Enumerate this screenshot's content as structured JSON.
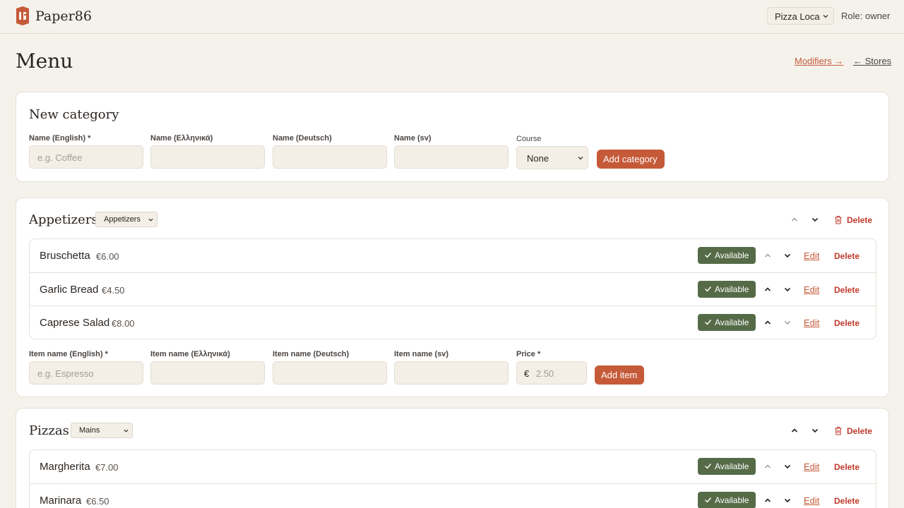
{
  "header": {
    "brand": "Paper86",
    "store": "Pizza Loca",
    "role": "Role: owner"
  },
  "page": {
    "title": "Menu",
    "modifiers_link": "Modifiers →",
    "stores_link": "← Stores"
  },
  "new_category": {
    "title": "New category",
    "fields": [
      {
        "label": "Name (English) *",
        "placeholder": "e.g. Coffee"
      },
      {
        "label": "Name (Ελληνικά)",
        "placeholder": ""
      },
      {
        "label": "Name (Deutsch)",
        "placeholder": ""
      },
      {
        "label": "Name (sv)",
        "placeholder": ""
      }
    ],
    "course_label": "Course",
    "course_value": "None",
    "add_label": "Add category"
  },
  "categories": [
    {
      "name": "Appetizers",
      "course": "Appetizers",
      "delete_label": "Delete",
      "items": [
        {
          "name": "Bruschetta",
          "price": "€6.00",
          "status": "Available",
          "edit": "Edit",
          "delete": "Delete"
        },
        {
          "name": "Garlic Bread",
          "price": "€4.50",
          "status": "Available",
          "edit": "Edit",
          "delete": "Delete"
        },
        {
          "name": "Caprese Salad",
          "price": "€8.00",
          "status": "Available",
          "edit": "Edit",
          "delete": "Delete"
        }
      ],
      "new_item": {
        "fields": [
          {
            "label": "Item name (English) *",
            "placeholder": "e.g. Espresso"
          },
          {
            "label": "Item name (Ελληνικά)",
            "placeholder": ""
          },
          {
            "label": "Item name (Deutsch)",
            "placeholder": ""
          },
          {
            "label": "Item name (sv)",
            "placeholder": ""
          }
        ],
        "price_label": "Price *",
        "currency": "€",
        "price_placeholder": "2.50",
        "add_label": "Add item"
      }
    },
    {
      "name": "Pizzas",
      "course": "Mains",
      "delete_label": "Delete",
      "items": [
        {
          "name": "Margherita",
          "price": "€7.00",
          "status": "Available",
          "edit": "Edit",
          "delete": "Delete"
        },
        {
          "name": "Marinara",
          "price": "€6.50",
          "status": "Available",
          "edit": "Edit",
          "delete": "Delete"
        }
      ]
    }
  ],
  "colors": {
    "accent": "#c55a39",
    "available": "#556b47",
    "danger": "#c0392b",
    "background": "#f5f2ec"
  },
  "icons": [
    "logo-icon",
    "chevron-down-icon",
    "chevron-up-icon",
    "trash-icon",
    "check-icon"
  ]
}
